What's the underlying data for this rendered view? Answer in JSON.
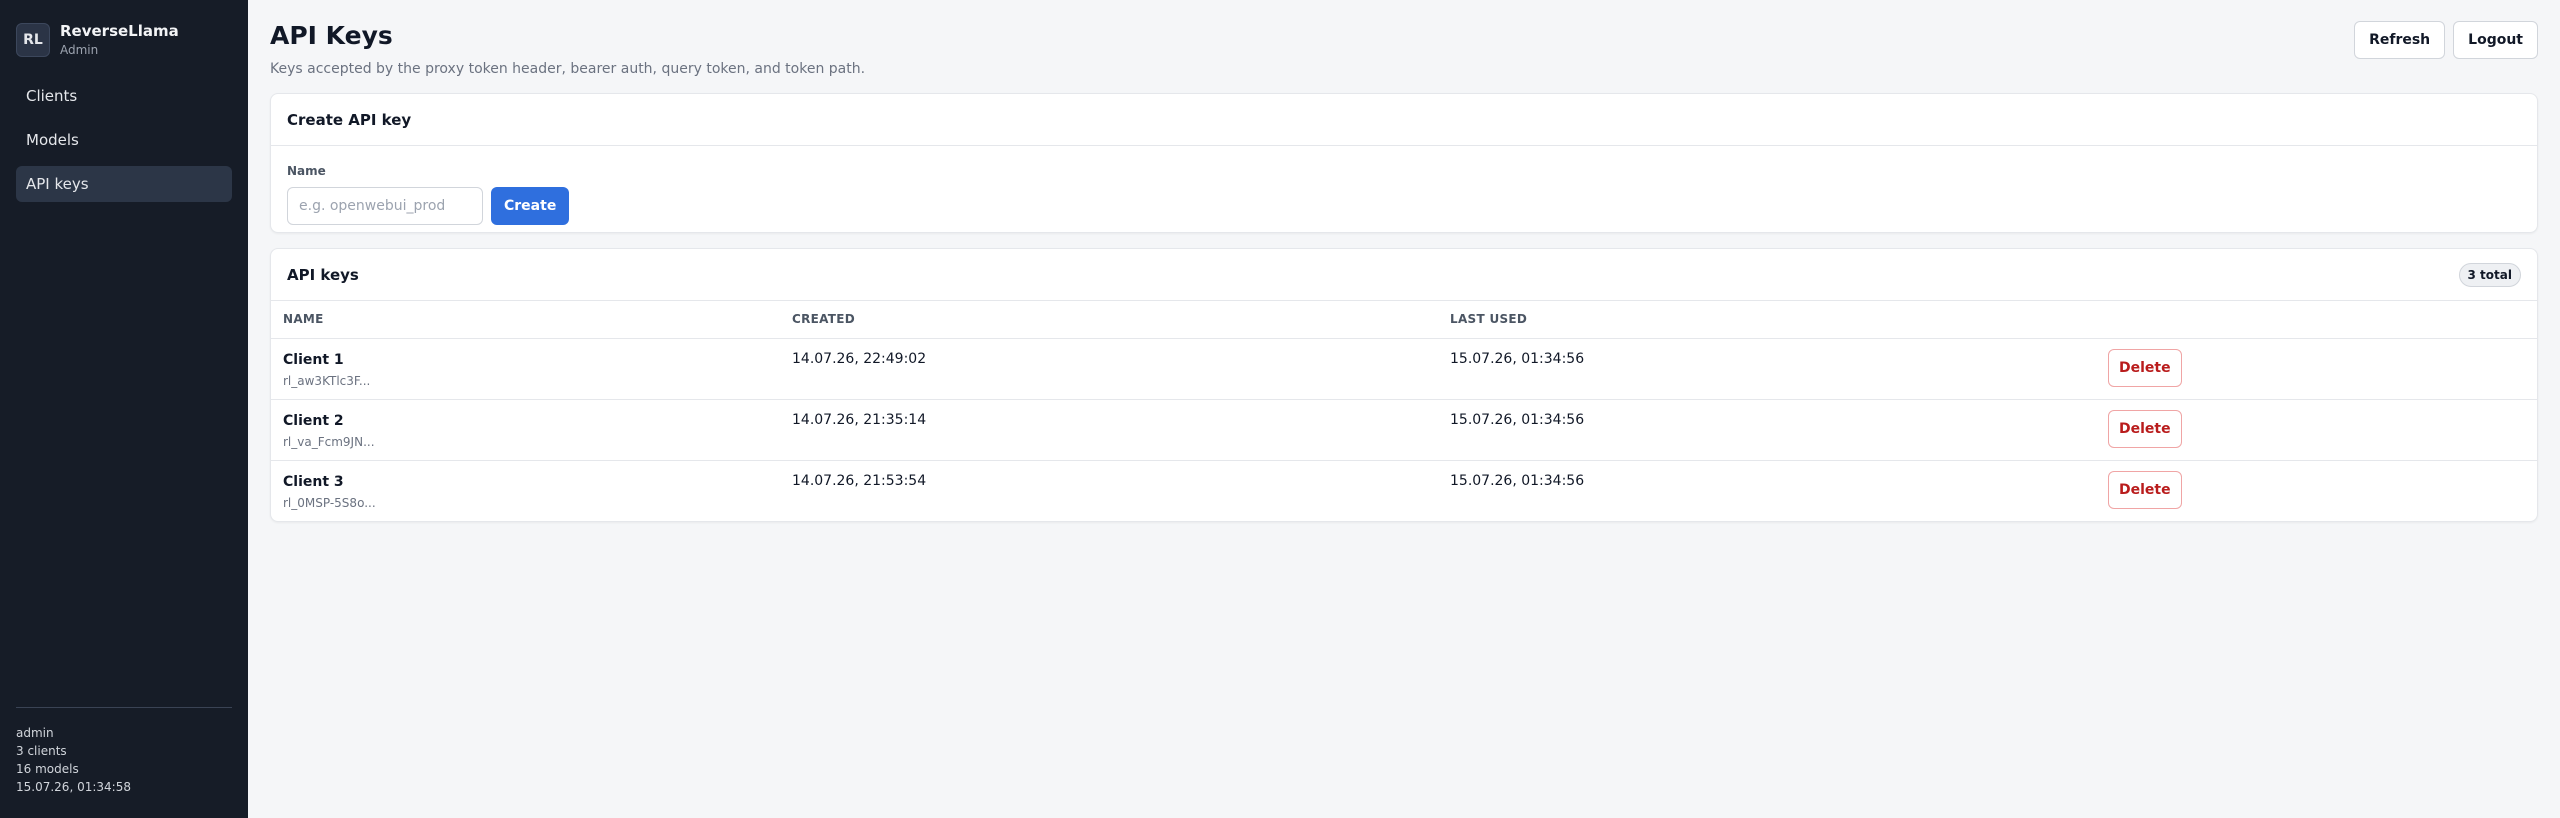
{
  "sidebar": {
    "brand_initials": "RL",
    "brand_name": "ReverseLlama",
    "brand_role": "Admin",
    "nav": [
      {
        "label": "Clients",
        "active": false
      },
      {
        "label": "Models",
        "active": false
      },
      {
        "label": "API keys",
        "active": true
      }
    ],
    "footer": {
      "user": "admin",
      "clients": "3 clients",
      "models": "16 models",
      "timestamp": "15.07.26, 01:34:58"
    }
  },
  "header": {
    "title": "API Keys",
    "subtitle": "Keys accepted by the proxy token header, bearer auth, query token, and token path.",
    "refresh_label": "Refresh",
    "logout_label": "Logout"
  },
  "create": {
    "title": "Create API key",
    "name_label": "Name",
    "name_value": "",
    "name_placeholder": "e.g. openwebui_prod",
    "create_label": "Create"
  },
  "keys": {
    "title": "API keys",
    "count_badge": "3 total",
    "columns": [
      "NAME",
      "CREATED",
      "LAST USED"
    ],
    "delete_label": "Delete",
    "rows": [
      {
        "name": "Client 1",
        "prefix": "rl_aw3KTlc3F...",
        "created": "14.07.26, 22:49:02",
        "last_used": "15.07.26, 01:34:56"
      },
      {
        "name": "Client 2",
        "prefix": "rl_va_Fcm9JN...",
        "created": "14.07.26, 21:35:14",
        "last_used": "15.07.26, 01:34:56"
      },
      {
        "name": "Client 3",
        "prefix": "rl_0MSP-5S8o...",
        "created": "14.07.26, 21:53:54",
        "last_used": "15.07.26, 01:34:56"
      }
    ]
  },
  "colors": {
    "sidebar_bg": "#161c27",
    "primary": "#2f6fde",
    "danger": "#b91c1c"
  }
}
